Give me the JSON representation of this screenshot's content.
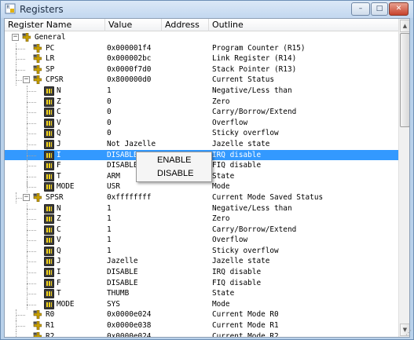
{
  "window": {
    "title": "Registers",
    "buttons": {
      "minimize": "–",
      "maximize": "□",
      "close": "✕"
    }
  },
  "columns": [
    "Register Name",
    "Value",
    "Address",
    "Outline"
  ],
  "rows": [
    {
      "name": "General",
      "value": "",
      "address": "",
      "outline": "",
      "kind": "group",
      "level": 0,
      "expander": "−"
    },
    {
      "name": "PC",
      "value": "0x000001f4",
      "address": "",
      "outline": "Program Counter (R15)",
      "kind": "reg",
      "level": 1
    },
    {
      "name": "LR",
      "value": "0x000002bc",
      "address": "",
      "outline": "Link Register (R14)",
      "kind": "reg",
      "level": 1
    },
    {
      "name": "SP",
      "value": "0x0000f7d0",
      "address": "",
      "outline": "Stack Pointer (R13)",
      "kind": "reg",
      "level": 1
    },
    {
      "name": "CPSR",
      "value": "0x800000d0",
      "address": "",
      "outline": "Current Status",
      "kind": "group",
      "level": 1,
      "expander": "−"
    },
    {
      "name": "N",
      "value": "1",
      "address": "",
      "outline": "Negative/Less than",
      "kind": "bit",
      "level": 2
    },
    {
      "name": "Z",
      "value": "0",
      "address": "",
      "outline": "Zero",
      "kind": "bit",
      "level": 2
    },
    {
      "name": "C",
      "value": "0",
      "address": "",
      "outline": "Carry/Borrow/Extend",
      "kind": "bit",
      "level": 2
    },
    {
      "name": "V",
      "value": "0",
      "address": "",
      "outline": "Overflow",
      "kind": "bit",
      "level": 2
    },
    {
      "name": "Q",
      "value": "0",
      "address": "",
      "outline": "Sticky overflow",
      "kind": "bit",
      "level": 2
    },
    {
      "name": "J",
      "value": "Not Jazelle",
      "address": "",
      "outline": "Jazelle state",
      "kind": "bit",
      "level": 2
    },
    {
      "name": "I",
      "value": "DISABLE",
      "address": "",
      "outline": "IRQ disable",
      "kind": "bit",
      "level": 2,
      "selected": true
    },
    {
      "name": "F",
      "value": "DISABLE",
      "address": "",
      "outline": "FIQ disable",
      "kind": "bit",
      "level": 2
    },
    {
      "name": "T",
      "value": "ARM",
      "address": "",
      "outline": "State",
      "kind": "bit",
      "level": 2
    },
    {
      "name": "MODE",
      "value": "USR",
      "address": "",
      "outline": "Mode",
      "kind": "bit",
      "level": 2
    },
    {
      "name": "SPSR",
      "value": "0xffffffff",
      "address": "",
      "outline": "Current Mode Saved Status",
      "kind": "group",
      "level": 1,
      "expander": "−"
    },
    {
      "name": "N",
      "value": "1",
      "address": "",
      "outline": "Negative/Less than",
      "kind": "bit",
      "level": 2
    },
    {
      "name": "Z",
      "value": "1",
      "address": "",
      "outline": "Zero",
      "kind": "bit",
      "level": 2
    },
    {
      "name": "C",
      "value": "1",
      "address": "",
      "outline": "Carry/Borrow/Extend",
      "kind": "bit",
      "level": 2
    },
    {
      "name": "V",
      "value": "1",
      "address": "",
      "outline": "Overflow",
      "kind": "bit",
      "level": 2
    },
    {
      "name": "Q",
      "value": "1",
      "address": "",
      "outline": "Sticky overflow",
      "kind": "bit",
      "level": 2
    },
    {
      "name": "J",
      "value": "Jazelle",
      "address": "",
      "outline": "Jazelle state",
      "kind": "bit",
      "level": 2
    },
    {
      "name": "I",
      "value": "DISABLE",
      "address": "",
      "outline": "IRQ disable",
      "kind": "bit",
      "level": 2
    },
    {
      "name": "F",
      "value": "DISABLE",
      "address": "",
      "outline": "FIQ disable",
      "kind": "bit",
      "level": 2
    },
    {
      "name": "T",
      "value": "THUMB",
      "address": "",
      "outline": "State",
      "kind": "bit",
      "level": 2
    },
    {
      "name": "MODE",
      "value": "SYS",
      "address": "",
      "outline": "Mode",
      "kind": "bit",
      "level": 2
    },
    {
      "name": "R0",
      "value": "0x0000e024",
      "address": "",
      "outline": "Current Mode R0",
      "kind": "reg",
      "level": 1
    },
    {
      "name": "R1",
      "value": "0x0000e038",
      "address": "",
      "outline": "Current Mode R1",
      "kind": "reg",
      "level": 1
    },
    {
      "name": "R2",
      "value": "0x0000e024",
      "address": "",
      "outline": "Current Mode R2",
      "kind": "reg",
      "level": 1
    }
  ],
  "context_menu": {
    "items": [
      "ENABLE",
      "DISABLE"
    ]
  },
  "colors": {
    "selection": "#3399ff",
    "bit_icon": "#f2d21c",
    "reg_icon": "#c9a100"
  },
  "icons": {
    "title": "registers-icon",
    "register": "register-icon",
    "bitfield": "bitfield-icon"
  }
}
